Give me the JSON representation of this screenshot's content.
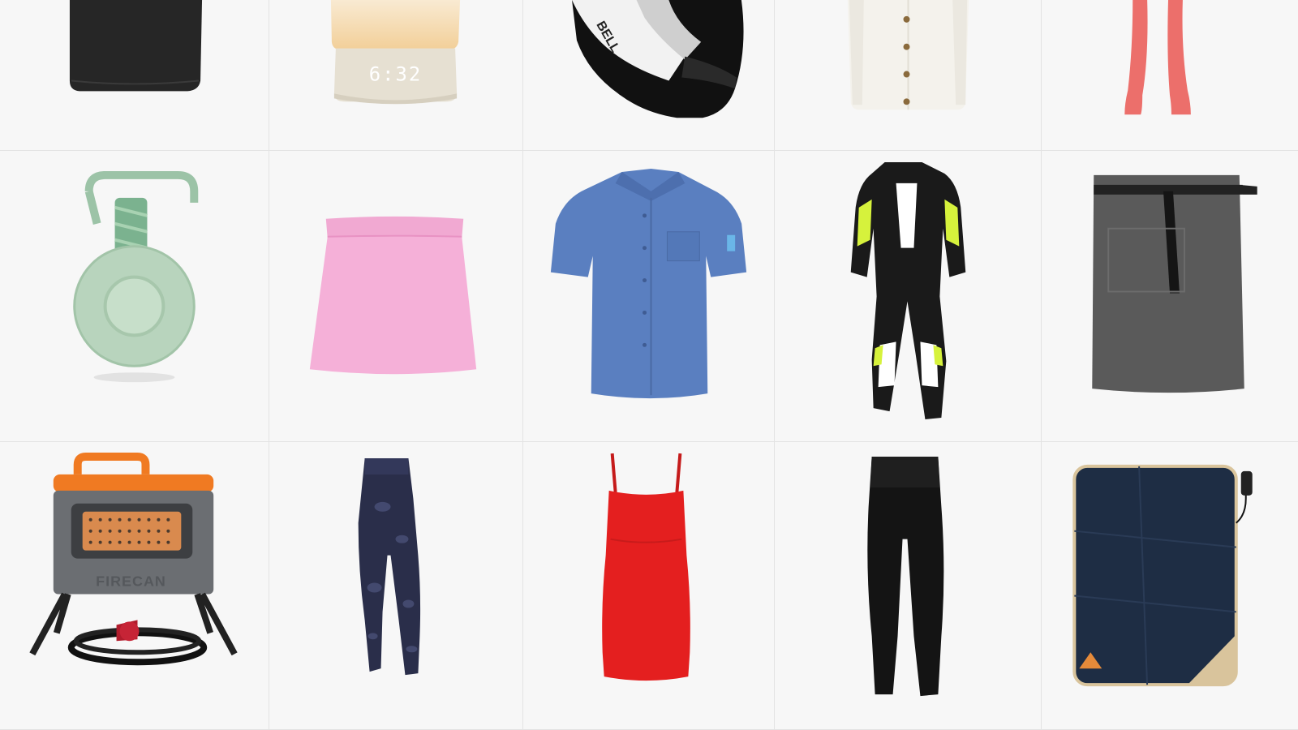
{
  "products": [
    {
      "icon": "black-crop-top-icon",
      "text": ""
    },
    {
      "icon": "sunrise-alarm-clock-icon",
      "text": "6:32"
    },
    {
      "icon": "motorcycle-helmet-icon",
      "text": "BELL"
    },
    {
      "icon": "white-button-cardigan-icon",
      "text": ""
    },
    {
      "icon": "coral-flared-pants-icon",
      "text": ""
    },
    {
      "icon": "green-tracker-keyring-icon",
      "text": ""
    },
    {
      "icon": "pink-mini-skirt-icon",
      "text": ""
    },
    {
      "icon": "blue-short-sleeve-shirt-icon",
      "text": ""
    },
    {
      "icon": "racing-leather-suit-icon",
      "text": ""
    },
    {
      "icon": "grey-bistro-apron-icon",
      "text": ""
    },
    {
      "icon": "portable-propane-heater-icon",
      "text": "FIRECAN"
    },
    {
      "icon": "navy-tie-dye-leggings-icon",
      "text": ""
    },
    {
      "icon": "red-slip-dress-icon",
      "text": ""
    },
    {
      "icon": "black-high-waist-leggings-icon",
      "text": ""
    },
    {
      "icon": "heated-navy-blanket-icon",
      "text": ""
    }
  ],
  "colors": {
    "cell_background": "#f7f7f7",
    "grid_line": "#e3e3e3"
  }
}
